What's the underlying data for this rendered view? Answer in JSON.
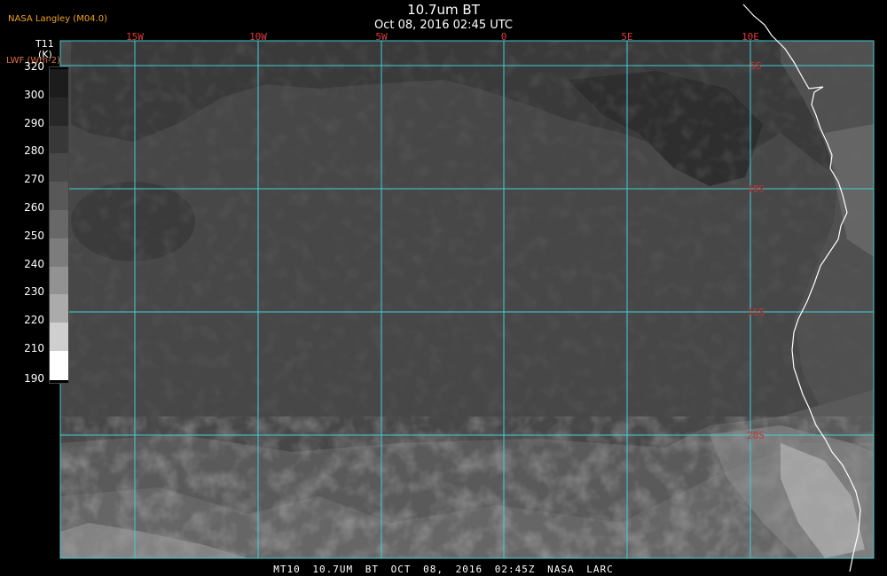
{
  "header": {
    "title": "10.7um BT",
    "timestamp": "Oct 08, 2016 02:45 UTC"
  },
  "source_label": "NASA Langley (M04.0)",
  "colorbar": {
    "variable": "T11",
    "unit": "(K)",
    "alt_label": "LWF (Wm-2)",
    "ticks": [
      "320",
      "300",
      "290",
      "280",
      "270",
      "260",
      "250",
      "240",
      "230",
      "220",
      "210",
      "190"
    ]
  },
  "map": {
    "longitude_labels": [
      "15W",
      "10W",
      "5W",
      "0",
      "5E",
      "10E"
    ],
    "latitude_labels": [
      "5S",
      "10S",
      "15S",
      "20S"
    ],
    "grid_color": "#40d0d8",
    "coastline_color": "#ffffff",
    "label_color_lon": "#e03a3a",
    "label_color_lat": "#c83030"
  },
  "footer": {
    "text": "MT10  10.7UM BT   OCT 08, 2016 02:45Z   NASA LARC"
  }
}
